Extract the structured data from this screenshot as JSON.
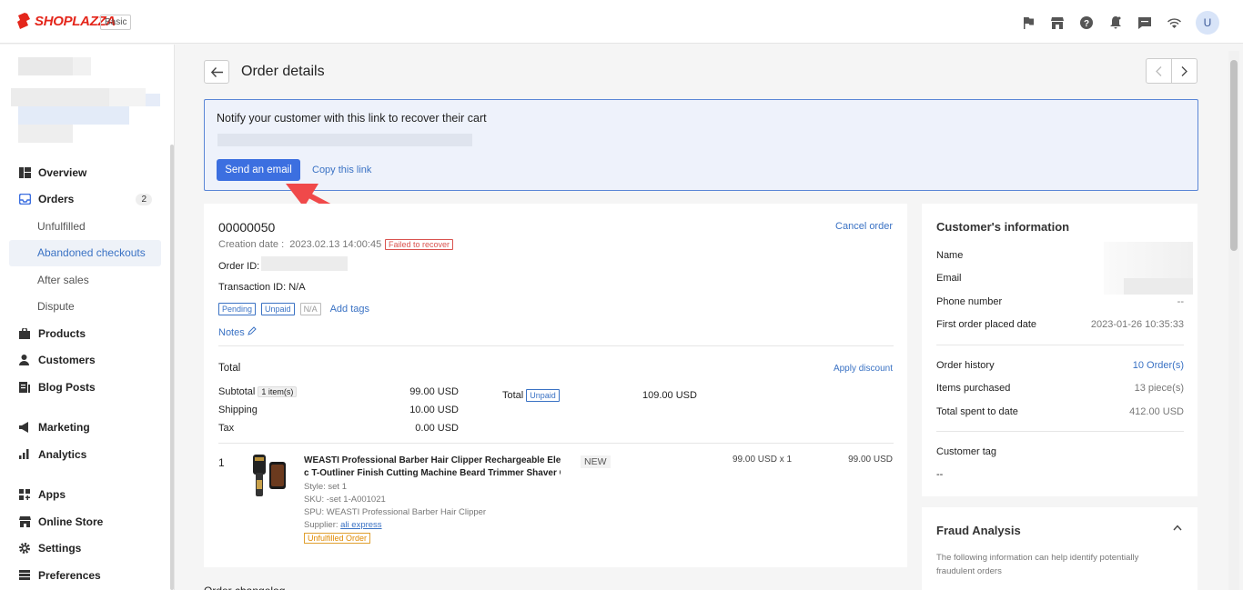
{
  "topbar": {
    "brand": "SHOPLAZZA",
    "plan": "Basic",
    "icons": [
      "flag-icon",
      "store-icon",
      "help-icon",
      "bell-icon",
      "chat-icon",
      "wifi-icon"
    ],
    "avatar_letter": "U"
  },
  "sidebar": {
    "items": [
      {
        "label": "Overview",
        "icon": "overview-icon"
      },
      {
        "label": "Orders",
        "icon": "orders-icon",
        "count": "2"
      },
      {
        "label": "Unfulfilled"
      },
      {
        "label": "Abandoned checkouts"
      },
      {
        "label": "After sales"
      },
      {
        "label": "Dispute"
      },
      {
        "label": "Products",
        "icon": "products-icon"
      },
      {
        "label": "Customers",
        "icon": "customers-icon"
      },
      {
        "label": "Blog Posts",
        "icon": "blog-icon"
      },
      {
        "label": "Marketing",
        "icon": "marketing-icon"
      },
      {
        "label": "Analytics",
        "icon": "analytics-icon"
      },
      {
        "label": "Apps",
        "icon": "apps-icon"
      },
      {
        "label": "Online Store",
        "icon": "online-store-icon"
      },
      {
        "label": "Settings",
        "icon": "settings-icon"
      },
      {
        "label": "Preferences",
        "icon": "preferences-icon"
      }
    ]
  },
  "header": {
    "title": "Order details"
  },
  "notify": {
    "title": "Notify your customer with this link to recover their cart",
    "send_label": "Send an email",
    "copy_label": "Copy this link"
  },
  "order": {
    "number": "00000050",
    "cancel_label": "Cancel order",
    "creation_date": "Creation date :  2023.02.13 14:00:45",
    "status": "Failed to recover",
    "order_id_label": "Order ID:",
    "transaction": "Transaction ID: N/A",
    "tags": [
      "Pending",
      "Unpaid",
      "N/A"
    ],
    "add_tags": "Add tags",
    "notes": "Notes",
    "total_heading": "Total",
    "apply_discount": "Apply discount",
    "subtotal_label": "Subtotal",
    "subtotal_items": "1 item(s)",
    "subtotal_value": "99.00 USD",
    "shipping_label": "Shipping",
    "shipping_value": "10.00 USD",
    "tax_label": "Tax",
    "tax_value": "0.00 USD",
    "total_label": "Total",
    "total_status": "Unpaid",
    "total_value": "109.00 USD"
  },
  "line_item": {
    "index": "1",
    "name_line1": "WEASTI Professional Barber Hair Clipper Rechargeable Electri",
    "name_line2": "c T-Outliner Finish Cutting Machine Beard Trimmer Shaver C...",
    "style": "Style: set 1",
    "sku": "SKU: -set 1-A001021",
    "spu": "SPU: WEASTI Professional Barber Hair Clipper",
    "supplier_label": "Supplier: ",
    "supplier_link": "ali express",
    "fulfillment": "Unfulfilled Order",
    "badge": "NEW",
    "price_qty": "99.00 USD x 1",
    "line_total": "99.00 USD"
  },
  "below": {
    "text": "Order changelog"
  },
  "customer": {
    "heading": "Customer's information",
    "name_label": "Name",
    "email_label": "Email",
    "phone_label": "Phone number",
    "phone_value": "--",
    "first_order_label": "First order placed date",
    "first_order_value": "2023-01-26 10:35:33",
    "history_label": "Order history",
    "history_value": "10 Order(s)",
    "items_label": "Items purchased",
    "items_value": "13 piece(s)",
    "spent_label": "Total spent to date",
    "spent_value": "412.00 USD",
    "tag_label": "Customer tag",
    "tag_value": "--"
  },
  "fraud": {
    "heading": "Fraud Analysis",
    "desc": "The following information can help identify potentially fraudulent orders"
  },
  "colors": {
    "accent": "#3c6fe0",
    "link": "#3a72c4",
    "brand": "#e4261b",
    "danger": "#d9534f"
  }
}
